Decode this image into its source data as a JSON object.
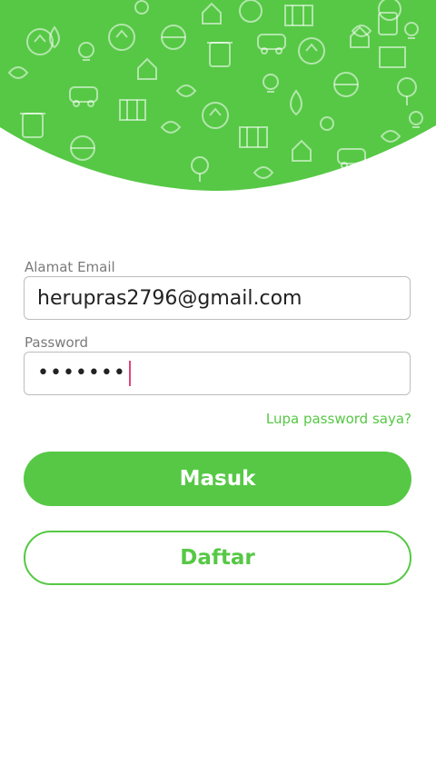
{
  "colors": {
    "brand_green": "#56c845",
    "label_gray": "#7a7a7a",
    "field_border": "#bdbdbd",
    "caret_pink": "#e0457b"
  },
  "header": {
    "icons": [
      "lightbulb-icon",
      "recycle-icon",
      "globe-icon",
      "trash-bin-icon",
      "car-icon",
      "building-icon",
      "tree-icon",
      "leaf-icon",
      "water-drop-icon",
      "house-icon"
    ]
  },
  "form": {
    "email": {
      "label": "Alamat Email",
      "value": "herupras2796@gmail.com"
    },
    "password": {
      "label": "Password",
      "masked_value": "•••••••"
    },
    "forgot_link": "Lupa password saya?",
    "login_button": "Masuk",
    "register_button": "Daftar"
  }
}
